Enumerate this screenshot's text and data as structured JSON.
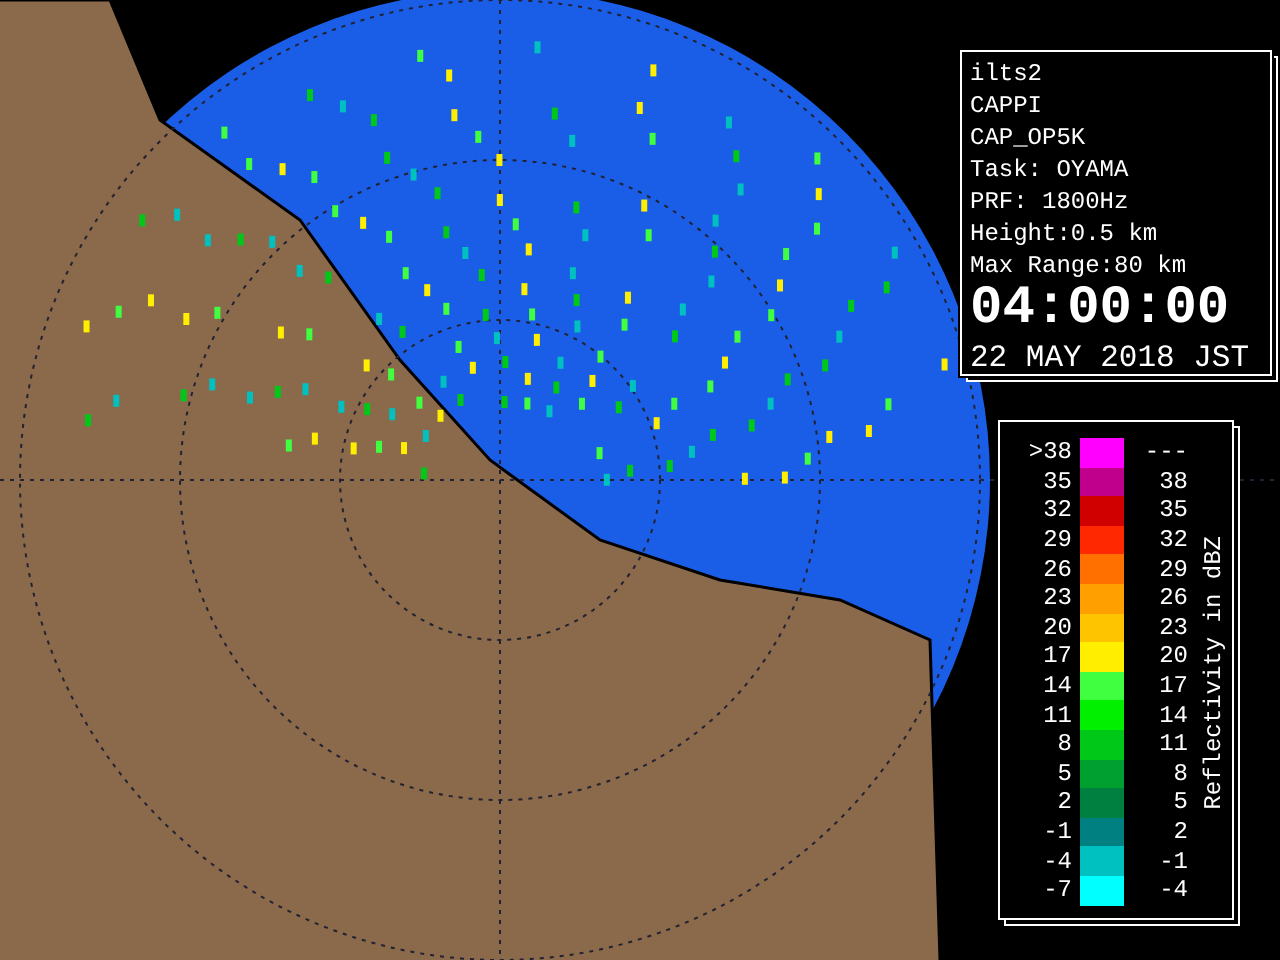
{
  "info_panel": {
    "lines": [
      "ilts2",
      "CAPPI",
      "CAP_OP5K",
      "Task: OYAMA",
      "PRF: 1800Hz",
      "Height:0.5 km",
      "Max Range:80 km"
    ],
    "time": "04:00:00",
    "date": "22 MAY 2018 JST"
  },
  "legend": {
    "title": "Reflectivity in dBZ",
    "rows": [
      {
        "low": ">38",
        "high": "---",
        "color": "#ff00ff"
      },
      {
        "low": "35",
        "high": "38",
        "color": "#c0008c"
      },
      {
        "low": "32",
        "high": "35",
        "color": "#d00000"
      },
      {
        "low": "29",
        "high": "32",
        "color": "#ff2800"
      },
      {
        "low": "26",
        "high": "29",
        "color": "#ff7000"
      },
      {
        "low": "23",
        "high": "26",
        "color": "#ffa000"
      },
      {
        "low": "20",
        "high": "23",
        "color": "#ffc400"
      },
      {
        "low": "17",
        "high": "20",
        "color": "#ffee00"
      },
      {
        "low": "14",
        "high": "17",
        "color": "#40ff40"
      },
      {
        "low": "11",
        "high": "14",
        "color": "#00f000"
      },
      {
        "low": "8",
        "high": "11",
        "color": "#00c818"
      },
      {
        "low": "5",
        "high": "8",
        "color": "#00a030"
      },
      {
        "low": "2",
        "high": "5",
        "color": "#008040"
      },
      {
        "low": "-1",
        "high": "2",
        "color": "#008080"
      },
      {
        "low": "-4",
        "high": "-1",
        "color": "#00c0c0"
      },
      {
        "low": "-7",
        "high": "-4",
        "color": "#00ffff"
      }
    ]
  }
}
